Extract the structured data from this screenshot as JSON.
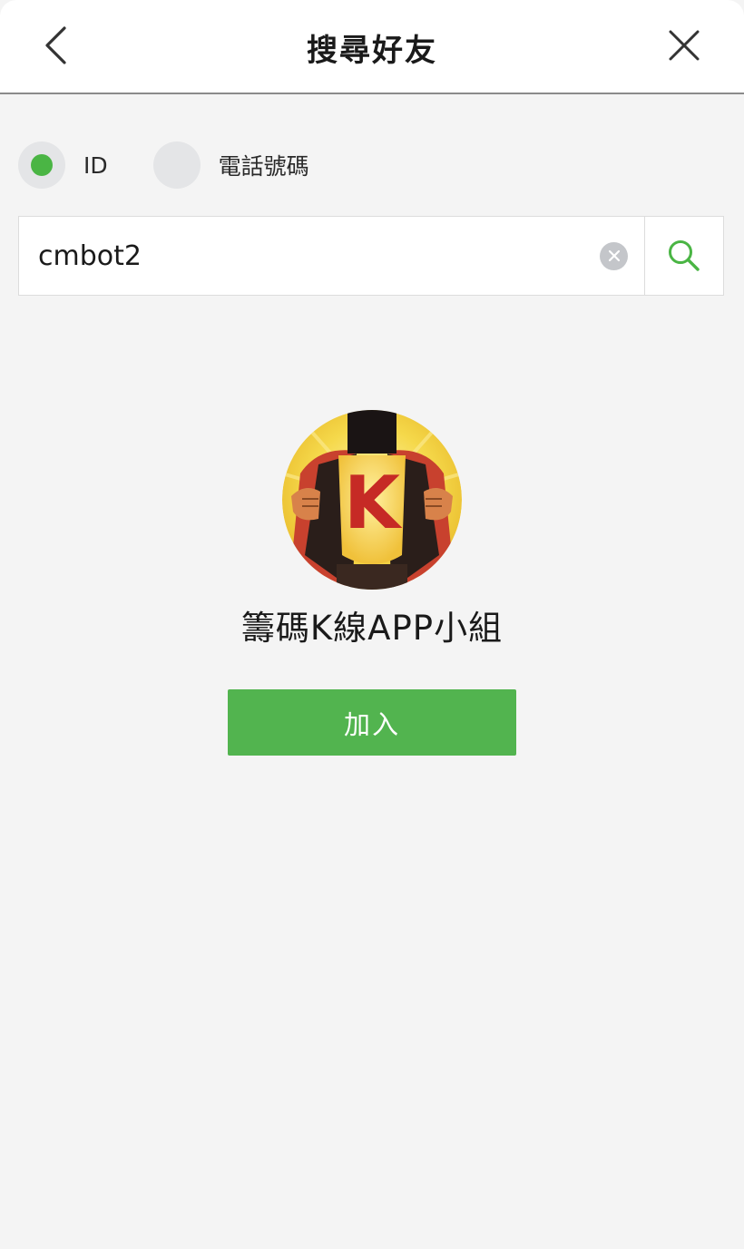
{
  "header": {
    "title": "搜尋好友",
    "back_icon": "chevron-left-icon",
    "close_icon": "close-icon"
  },
  "search_type": {
    "options": [
      {
        "label": "ID",
        "selected": true
      },
      {
        "label": "電話號碼",
        "selected": false
      }
    ]
  },
  "search": {
    "value": "cmbot2",
    "clear_icon": "clear-icon",
    "search_icon": "search-icon"
  },
  "result": {
    "avatar": "superhero-k-logo",
    "avatar_letter": "K",
    "name": "籌碼K線APP小組",
    "add_label": "加入"
  },
  "colors": {
    "accent": "#52b44f",
    "radio_selected": "#4ab544",
    "background": "#f4f4f4"
  }
}
